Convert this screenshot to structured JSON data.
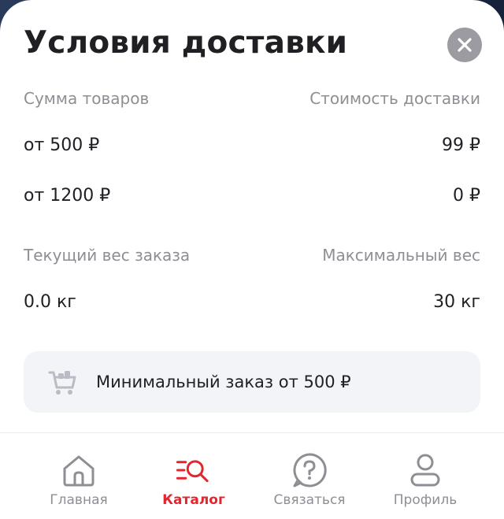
{
  "sheet": {
    "title": "Условия доставки"
  },
  "delivery": {
    "sum_header": "Сумма товаров",
    "cost_header": "Стоимость доставки",
    "tiers": [
      {
        "amount": "от 500 ₽",
        "cost": "99 ₽"
      },
      {
        "amount": "от 1200 ₽",
        "cost": "0 ₽"
      }
    ]
  },
  "weight": {
    "current_label": "Текущий вес заказа",
    "max_label": "Максимальный вес",
    "current_value": "0.0 кг",
    "max_value": "30 кг"
  },
  "banner": {
    "text": "Минимальный заказ от 500 ₽"
  },
  "tabbar": {
    "items": [
      {
        "label": "Главная",
        "icon": "home-icon",
        "active": false
      },
      {
        "label": "Каталог",
        "icon": "catalog-search-icon",
        "active": true
      },
      {
        "label": "Связаться",
        "icon": "question-icon",
        "active": false
      },
      {
        "label": "Профиль",
        "icon": "profile-icon",
        "active": false
      }
    ]
  },
  "colors": {
    "accent": "#e3262d",
    "muted_text": "#8e8e95",
    "primary_text": "#1f1f24",
    "banner_bg": "#f3f4f7",
    "close_bg": "#9b9ba1"
  }
}
